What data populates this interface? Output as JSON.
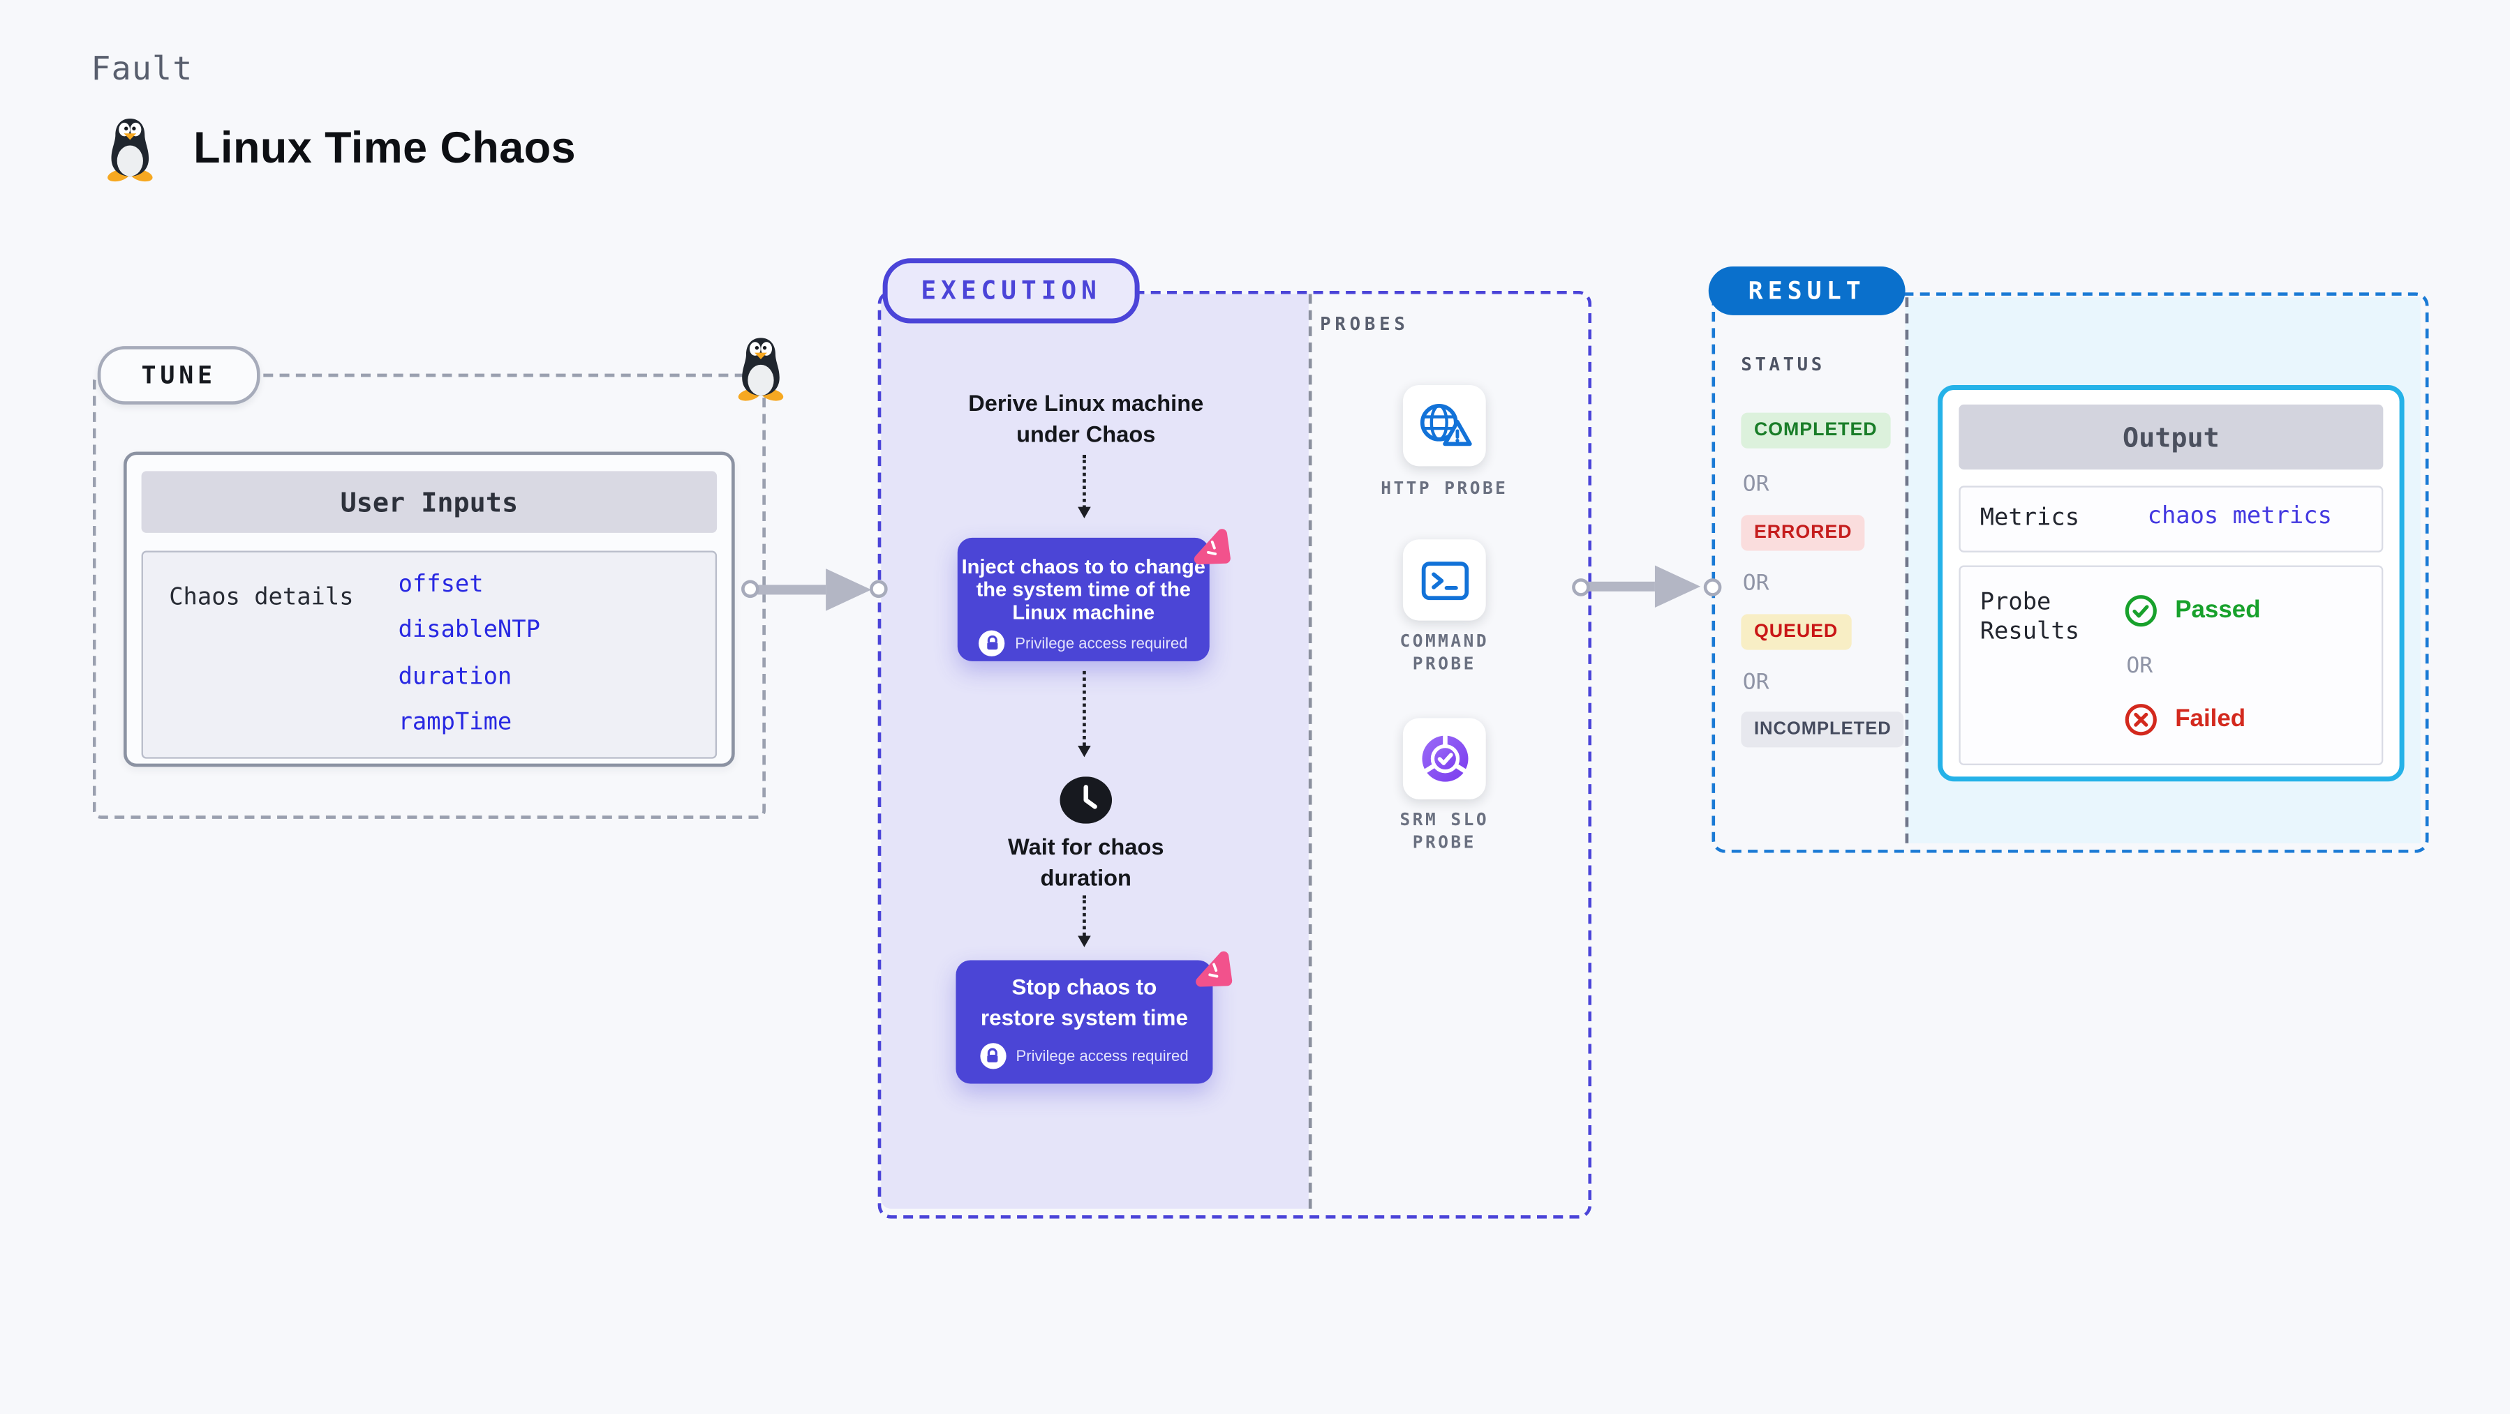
{
  "header": {
    "category_label": "Fault",
    "title": "Linux Time Chaos",
    "icon": "tux-penguin-icon"
  },
  "tune": {
    "badge": "TUNE",
    "user_inputs": {
      "title": "User Inputs",
      "row_label": "Chaos details",
      "values": [
        "offset",
        "disableNTP",
        "duration",
        "rampTime"
      ]
    }
  },
  "execution": {
    "badge": "EXECUTION",
    "derive_lines": [
      "Derive Linux machine",
      "under Chaos"
    ],
    "inject": {
      "lines": [
        "Inject chaos to to change",
        "the system time of the",
        "Linux machine"
      ],
      "privilege_note": "Privilege access required"
    },
    "wait_lines": [
      "Wait for chaos",
      "duration"
    ],
    "stop": {
      "lines": [
        "Stop chaos to",
        "restore system time"
      ],
      "privilege_note": "Privilege access required"
    }
  },
  "probes": {
    "section_label": "PROBES",
    "items": [
      {
        "icon": "globe-alert-icon",
        "label_lines": [
          "HTTP PROBE",
          ""
        ]
      },
      {
        "icon": "terminal-icon",
        "label_lines": [
          "COMMAND",
          "PROBE"
        ]
      },
      {
        "icon": "slo-pie-icon",
        "label_lines": [
          "SRM SLO",
          "PROBE"
        ]
      }
    ]
  },
  "result": {
    "badge": "RESULT",
    "status_label": "STATUS",
    "or_label": "OR",
    "statuses": [
      {
        "label": "COMPLETED",
        "fg": "#197d28",
        "bg": "#dcf1dc"
      },
      {
        "label": "ERRORED",
        "fg": "#c51d1d",
        "bg": "#fadddd"
      },
      {
        "label": "QUEUED",
        "fg": "#c91616",
        "bg": "#f8eec5"
      },
      {
        "label": "INCOMPLETED",
        "fg": "#454b5e",
        "bg": "#e7e8ee"
      }
    ],
    "output": {
      "title": "Output",
      "metrics_label": "Metrics",
      "metrics_value": "chaos metrics",
      "probe_results_lines": [
        "Probe",
        "Results"
      ],
      "passed_label": "Passed",
      "failed_label": "Failed",
      "or_label": "OR"
    }
  },
  "colors": {
    "page_bg": "#f7f8fb",
    "execution_accent": "#4b44d8",
    "execution_fill": "#e5e4f9",
    "step_box_bg": "#4b45d6",
    "chaos_logo_pink": "#f2528c",
    "result_pill_blue": "#0a70cc",
    "result_dash_blue": "#1a7ad5",
    "output_panel_bg": "#e9f6fd",
    "output_border_cyan": "#25b2e8",
    "probe_icon_blue": "#1272d8",
    "srm_purple": "#7a3bee",
    "link_blue": "#2828e2",
    "passed_green": "#18a12c",
    "failed_red": "#d3291e"
  }
}
